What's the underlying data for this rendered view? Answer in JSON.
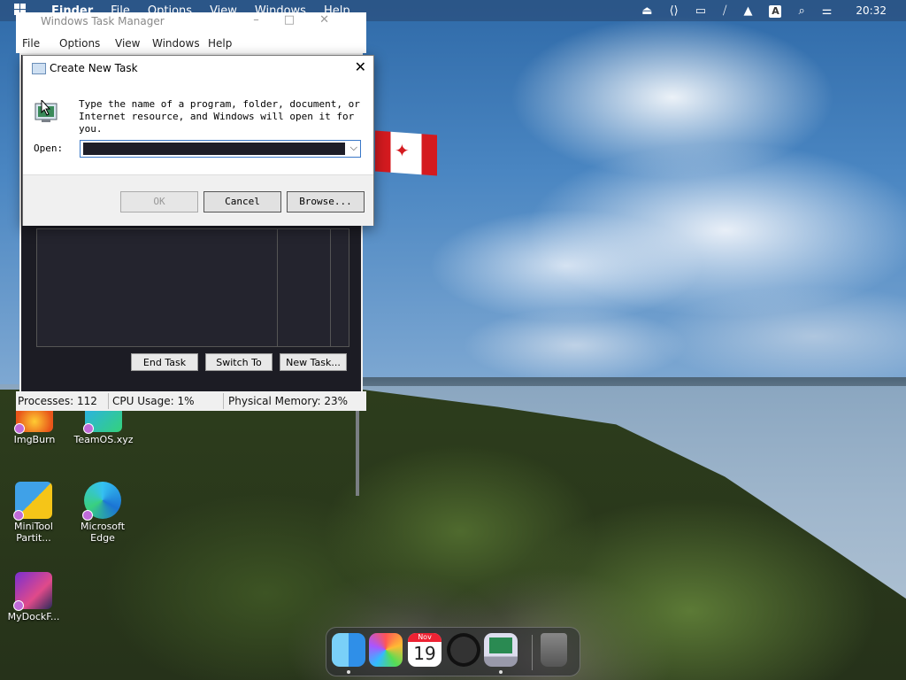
{
  "menubar": {
    "app": "Finder",
    "menus": [
      "File",
      "Options",
      "View",
      "Windows",
      "Help"
    ],
    "clock": "20:32",
    "input_badge": "A"
  },
  "task_manager": {
    "title": "Windows Task Manager",
    "menus": [
      "File",
      "Options",
      "View",
      "Windows",
      "Help"
    ],
    "buttons": {
      "end_task": "End Task",
      "switch_to": "Switch To",
      "new_task": "New Task..."
    },
    "status": {
      "processes": "Processes: 112",
      "cpu": "CPU Usage: 1%",
      "memory": "Physical Memory: 23%"
    }
  },
  "dialog": {
    "title": "Create New Task",
    "description": "Type the name of a program, folder, document, or Internet resource, and Windows will open it for you.",
    "open_label": "Open:",
    "buttons": {
      "ok": "OK",
      "cancel": "Cancel",
      "browse": "Browse..."
    }
  },
  "desktop_icons": [
    {
      "label": "ImgBurn"
    },
    {
      "label": "TeamOS.xyz"
    },
    {
      "label": "MiniTool Partit..."
    },
    {
      "label": "Microsoft Edge"
    },
    {
      "label": "MyDockF..."
    }
  ],
  "dock": {
    "calendar": {
      "month": "Nov",
      "day": "19"
    }
  },
  "colors": {
    "accent": "#3a78c8",
    "flag_red": "#d41a1f"
  }
}
